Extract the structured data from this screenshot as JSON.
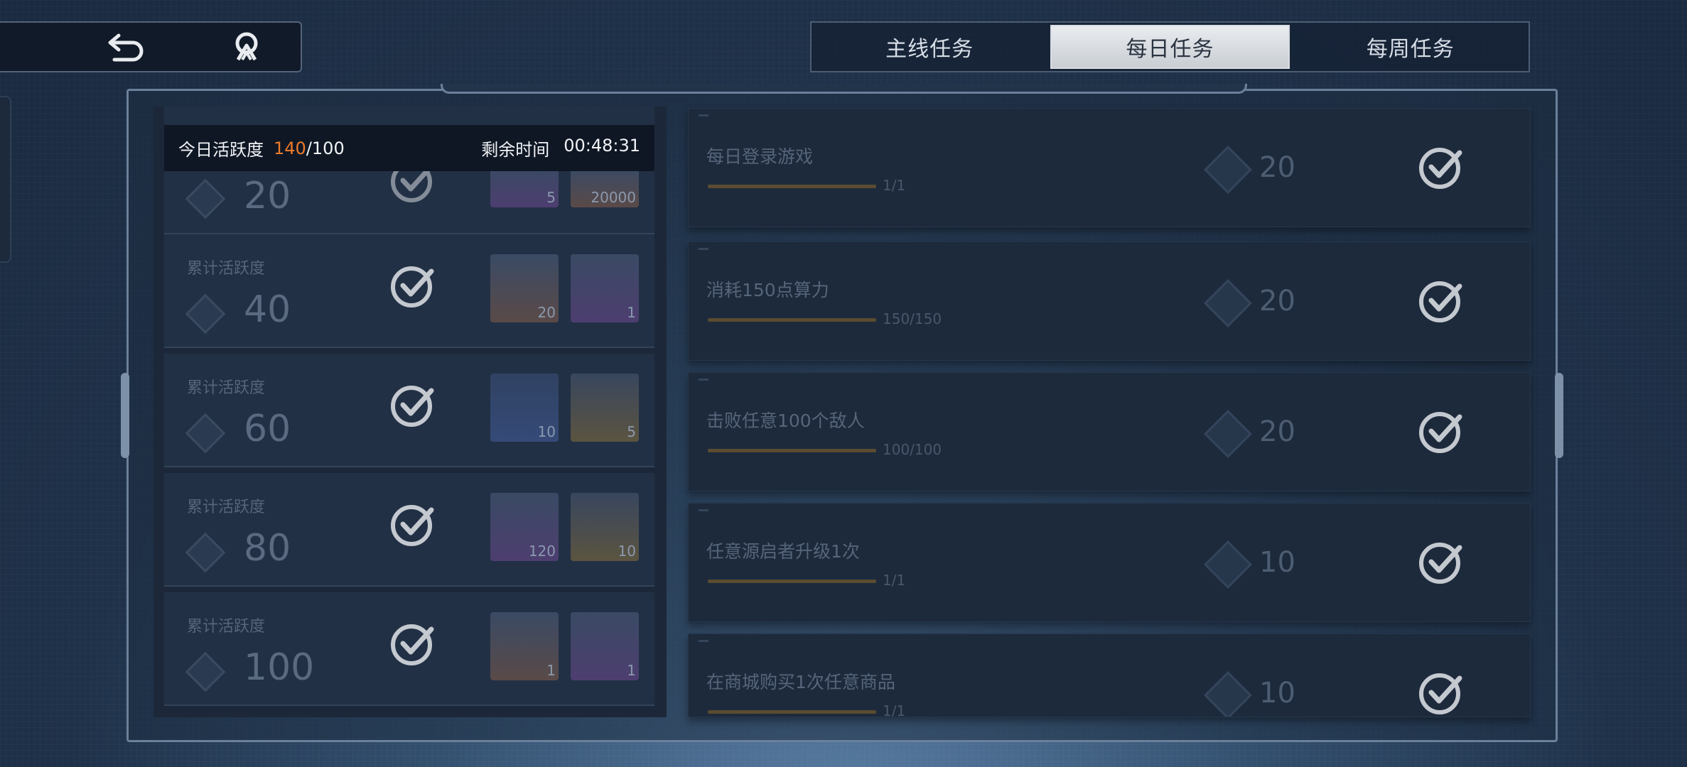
{
  "nav": {
    "back_icon": "back-arrow-icon",
    "home_icon": "home-icon"
  },
  "tabs": [
    {
      "label": "主线任务",
      "active": false
    },
    {
      "label": "每日任务",
      "active": true
    },
    {
      "label": "每周任务",
      "active": false
    }
  ],
  "activity": {
    "label": "今日活跃度",
    "current": "140",
    "max": "/100",
    "remaining_label": "剩余时间",
    "remaining_time": "00:48:31"
  },
  "milestones": [
    {
      "label": "累计活跃度",
      "value": "20",
      "items": [
        {
          "count": "5",
          "color": "purple"
        },
        {
          "count": "20000",
          "color": "orange"
        }
      ]
    },
    {
      "label": "累计活跃度",
      "value": "40",
      "items": [
        {
          "count": "20",
          "color": "orange"
        },
        {
          "count": "1",
          "color": "purple"
        }
      ]
    },
    {
      "label": "累计活跃度",
      "value": "60",
      "items": [
        {
          "count": "10",
          "color": "blue"
        },
        {
          "count": "5",
          "color": "gold"
        }
      ]
    },
    {
      "label": "累计活跃度",
      "value": "80",
      "items": [
        {
          "count": "120",
          "color": "purple"
        },
        {
          "count": "10",
          "color": "gold"
        }
      ]
    },
    {
      "label": "累计活跃度",
      "value": "100",
      "items": [
        {
          "count": "1",
          "color": "orange"
        },
        {
          "count": "1",
          "color": "purple"
        }
      ]
    }
  ],
  "tasks": [
    {
      "title": "每日登录游戏",
      "progress": "1/1",
      "reward": "20"
    },
    {
      "title": "消耗150点算力",
      "progress": "150/150",
      "reward": "20"
    },
    {
      "title": "击败任意100个敌人",
      "progress": "100/100",
      "reward": "20"
    },
    {
      "title": "任意源启者升级1次",
      "progress": "1/1",
      "reward": "10"
    },
    {
      "title": "在商城购买1次任意商品",
      "progress": "1/1",
      "reward": "10"
    }
  ],
  "colors": {
    "accent_orange": "#ee7b2b",
    "check_gray": "#c4c9d0"
  }
}
